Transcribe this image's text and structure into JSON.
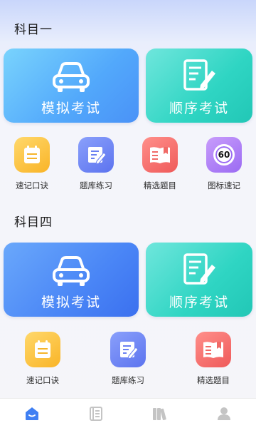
{
  "section1": {
    "title": "科目一",
    "cards": [
      {
        "label": "模拟考试",
        "icon": "car-icon"
      },
      {
        "label": "顺序考试",
        "icon": "document-edit-icon"
      }
    ],
    "tools": [
      {
        "label": "速记口诀",
        "icon": "notepad-icon"
      },
      {
        "label": "题库练习",
        "icon": "edit-list-icon"
      },
      {
        "label": "精选题目",
        "icon": "book-icon"
      },
      {
        "label": "图标速记",
        "icon": "speed-limit-icon",
        "badge": "60"
      }
    ]
  },
  "section4": {
    "title": "科目四",
    "cards": [
      {
        "label": "模拟考试",
        "icon": "car-icon"
      },
      {
        "label": "顺序考试",
        "icon": "document-edit-icon"
      }
    ],
    "tools": [
      {
        "label": "速记口诀",
        "icon": "notepad-icon"
      },
      {
        "label": "题库练习",
        "icon": "edit-list-icon"
      },
      {
        "label": "精选题目",
        "icon": "book-icon"
      }
    ]
  },
  "nav": [
    {
      "icon": "home-icon",
      "active": true
    },
    {
      "icon": "list-icon",
      "active": false
    },
    {
      "icon": "books-icon",
      "active": false
    },
    {
      "icon": "profile-icon",
      "active": false
    }
  ],
  "colors": {
    "accent": "#3f7ff3",
    "teal": "#2fd5c3",
    "nav_inactive": "#c4c4c4"
  }
}
